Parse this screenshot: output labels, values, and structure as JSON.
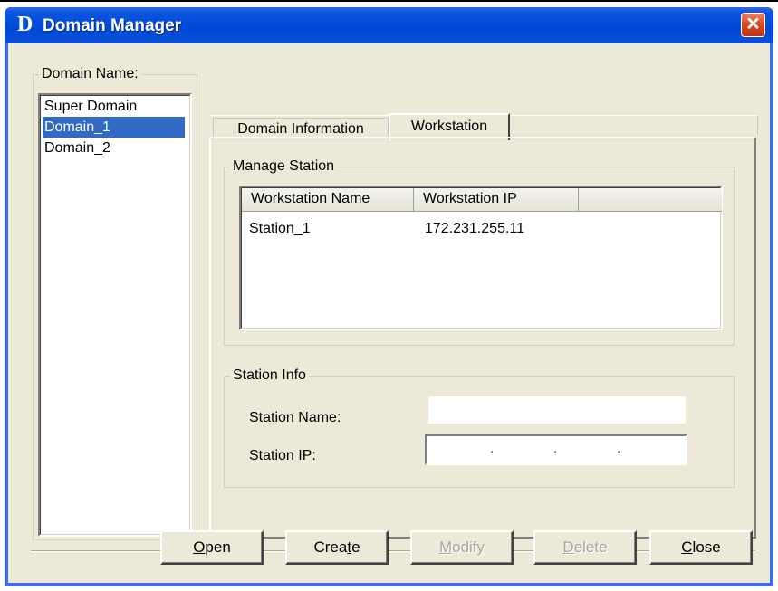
{
  "window": {
    "logo": "D",
    "title": "Domain Manager",
    "close_symbol": "✕"
  },
  "domain_group": {
    "label": "Domain Name:",
    "items": [
      {
        "label": "Super Domain",
        "selected": false
      },
      {
        "label": "Domain_1",
        "selected": true
      },
      {
        "label": "Domain_2",
        "selected": false
      }
    ]
  },
  "tabs": [
    {
      "label": "Domain Information",
      "active": false
    },
    {
      "label": "Workstation",
      "active": true
    }
  ],
  "manage_station": {
    "label": "Manage Station",
    "columns": [
      "Workstation Name",
      "Workstation IP"
    ],
    "rows": [
      {
        "name": "Station_1",
        "ip": "172.231.255.11"
      }
    ]
  },
  "station_info": {
    "label": "Station Info",
    "name_label": "Station Name:",
    "name_value": "",
    "ip_label": "Station IP:",
    "ip_dots": [
      ".",
      ".",
      "."
    ]
  },
  "buttons": {
    "open": {
      "pre": "",
      "acc": "O",
      "post": "pen",
      "enabled": true
    },
    "create": {
      "pre": "Crea",
      "acc": "t",
      "post": "e",
      "enabled": true
    },
    "modify": {
      "pre": "",
      "acc": "M",
      "post": "odify",
      "enabled": false
    },
    "delete": {
      "pre": "",
      "acc": "D",
      "post": "elete",
      "enabled": false
    },
    "close": {
      "pre": "",
      "acc": "C",
      "post": "lose",
      "enabled": true
    }
  },
  "colors": {
    "titlebar": "#0049d8",
    "client_bg": "#ece9d8",
    "selection": "#316ac5",
    "close_button": "#d6481f"
  }
}
